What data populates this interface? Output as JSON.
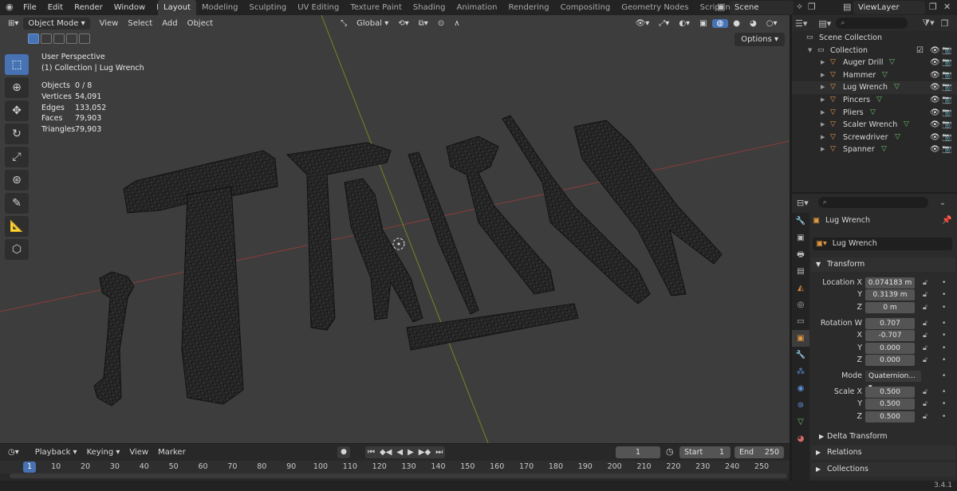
{
  "menu": [
    "File",
    "Edit",
    "Render",
    "Window",
    "Help"
  ],
  "workspaces": [
    "Layout",
    "Modeling",
    "Sculpting",
    "UV Editing",
    "Texture Paint",
    "Shading",
    "Animation",
    "Rendering",
    "Compositing",
    "Geometry Nodes",
    "Scripting"
  ],
  "active_workspace": "Layout",
  "scene": "Scene",
  "view_layer": "ViewLayer",
  "viewport": {
    "mode": "Object Mode",
    "menus": [
      "View",
      "Select",
      "Add",
      "Object"
    ],
    "orientation": "Global",
    "options_label": "Options",
    "perspective": "User Perspective",
    "context": "(1) Collection | Lug Wrench",
    "stats": [
      {
        "label": "Objects",
        "value": "0 / 8"
      },
      {
        "label": "Vertices",
        "value": "54,091"
      },
      {
        "label": "Edges",
        "value": "133,052"
      },
      {
        "label": "Faces",
        "value": "79,903"
      },
      {
        "label": "Triangles",
        "value": "79,903"
      }
    ]
  },
  "outliner": {
    "scene_collection": "Scene Collection",
    "collection": "Collection",
    "objects": [
      "Auger Drill",
      "Hammer",
      "Lug Wrench",
      "Pincers",
      "Pliers",
      "Scaler Wrench",
      "Screwdriver",
      "Spanner"
    ]
  },
  "properties": {
    "object_name": "Lug Wrench",
    "data_name": "Lug Wrench",
    "transform_label": "Transform",
    "location_label": "Location X",
    "location": [
      "0.074183 m",
      "0.3139 m",
      "0 m"
    ],
    "rotation_label": "Rotation W",
    "rotation": [
      "0.707",
      "-0.707",
      "0.000",
      "0.000"
    ],
    "mode_label": "Mode",
    "mode_value": "Quaternion...",
    "scale_label": "Scale X",
    "scale": [
      "0.500",
      "0.500",
      "0.500"
    ],
    "axis_y": "Y",
    "axis_z": "Z",
    "axis_x": "X",
    "delta_transform": "Delta Transform",
    "relations": "Relations",
    "collections": "Collections"
  },
  "timeline": {
    "menus": [
      "Playback",
      "Keying",
      "View",
      "Marker"
    ],
    "current_frame": "1",
    "start_label": "Start",
    "start": "1",
    "end_label": "End",
    "end": "250",
    "ruler": [
      "1",
      "10",
      "20",
      "30",
      "40",
      "50",
      "60",
      "70",
      "80",
      "90",
      "100",
      "110",
      "120",
      "130",
      "140",
      "150",
      "160",
      "170",
      "180",
      "190",
      "200",
      "210",
      "220",
      "230",
      "240",
      "250"
    ]
  },
  "version": "3.4.1",
  "colors": {
    "accent": "#4772b3",
    "object_icon": "#e49a42",
    "mesh_icon": "#6ec26e"
  }
}
